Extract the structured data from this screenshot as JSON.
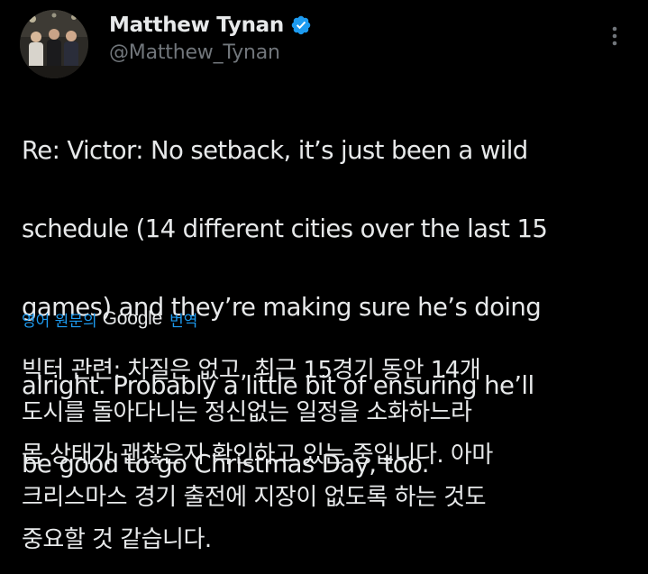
{
  "author": {
    "display_name": "Matthew Tynan",
    "handle": "@Matthew_Tynan",
    "verified": true,
    "avatar_icon": "profile-photo",
    "verified_icon": "verified-badge-icon",
    "more_icon": "more-options-icon"
  },
  "tweet": {
    "lines": [
      "Re: Victor: No setback, it’s just been a wild",
      "schedule (14 different cities over the last 15",
      "games) and they’re making sure he’s doing",
      "alright. Probably a little bit of ensuring he’ll",
      "be good to go Christmas Day, too."
    ]
  },
  "translation": {
    "prefix": "영어 원문의",
    "provider": "Google",
    "suffix": "번역",
    "lines": [
      "빅터 관련: 차질은 없고, 최근 15경기 동안 14개",
      "도시를 돌아다니는 정신없는 일정을 소화하느라",
      "몸 상태가 괜찮은지 확인하고 있는 중입니다. 아마",
      "크리스마스 경기 출전에 지장이 없도록 하는 것도",
      "중요할 것 같습니다."
    ]
  },
  "colors": {
    "background": "#000000",
    "text_primary": "#e7e9ea",
    "text_secondary": "#71767b",
    "accent": "#1d9bf0"
  }
}
